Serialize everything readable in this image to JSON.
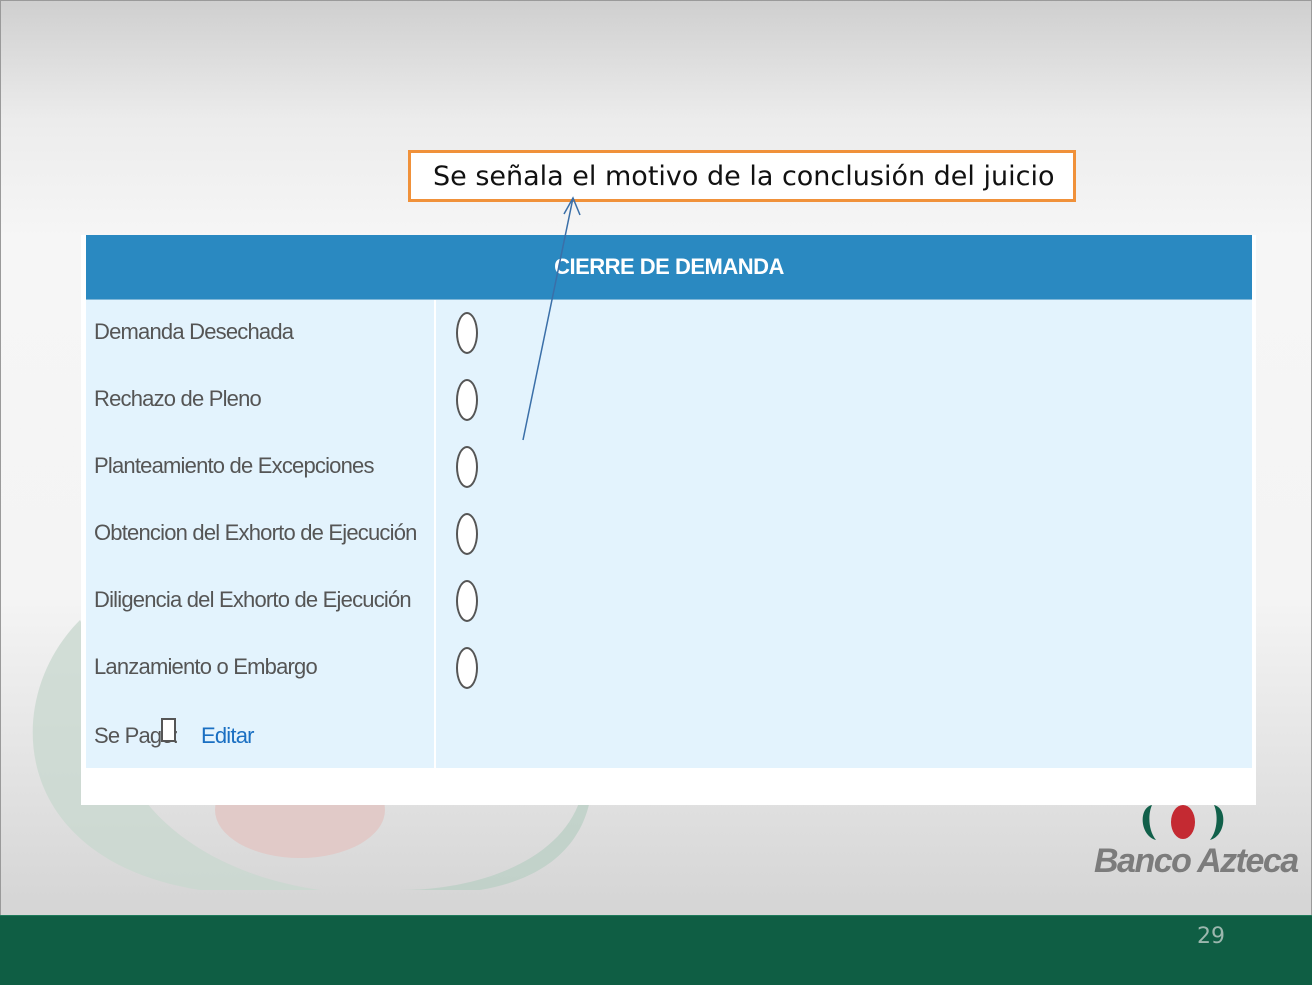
{
  "callout": {
    "text": "Se señala el motivo de la conclusión del juicio"
  },
  "form": {
    "title": "CIERRE DE DEMANDA",
    "options": [
      {
        "label": "Demanda Desechada"
      },
      {
        "label": "Rechazo de Pleno"
      },
      {
        "label": "Planteamiento de Excepciones"
      },
      {
        "label": "Obtencion del Exhorto de Ejecución"
      },
      {
        "label": "Diligencia del Exhorto de Ejecución"
      },
      {
        "label": "Lanzamiento o Embargo"
      }
    ],
    "paid_label": "Se Pago:",
    "edit_link": "Editar"
  },
  "logo": {
    "text": "Banco Azteca"
  },
  "footer": {
    "page_number": "29"
  },
  "colors": {
    "header_blue": "#2a89c1",
    "form_bg": "#e3f3fd",
    "callout_border": "#f0913a",
    "footer_green": "#0f5e44",
    "link_blue": "#1a6fc2"
  }
}
